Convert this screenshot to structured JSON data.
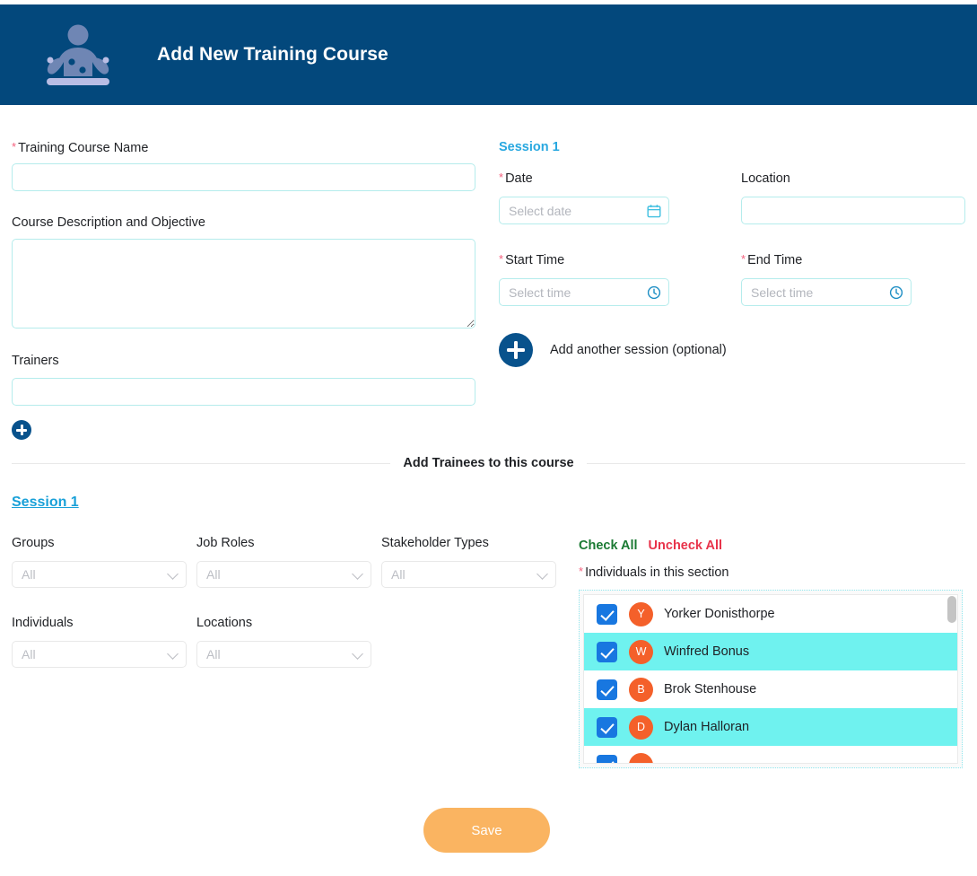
{
  "header": {
    "title": "Add New Training Course",
    "logo_icon": "trainer-person-icon",
    "bg_color": "#03487c"
  },
  "course": {
    "name_label": "Training Course Name",
    "name_value": "",
    "name_placeholder": "",
    "description_label": "Course Description and Objective",
    "description_value": "",
    "description_placeholder": "",
    "trainers_label": "Trainers",
    "trainers_value": "",
    "trainers_placeholder": "",
    "add_trainer_icon": "plus-circle-icon"
  },
  "session": {
    "heading": "Session 1",
    "date_label": "Date",
    "date_placeholder": "Select date",
    "date_value": "",
    "date_icon": "calendar-icon",
    "location_label": "Location",
    "location_value": "",
    "location_placeholder": "",
    "start_time_label": "Start Time",
    "start_time_placeholder": "Select time",
    "start_time_value": "",
    "start_time_icon": "clock-icon",
    "end_time_label": "End Time",
    "end_time_placeholder": "Select time",
    "end_time_value": "",
    "end_time_icon": "clock-icon",
    "add_session_label": "Add another session (optional)",
    "add_session_icon": "plus-circle-icon"
  },
  "trainees": {
    "divider_title": "Add Trainees to this course",
    "session_link": "Session 1",
    "filters": [
      {
        "label": "Groups",
        "value": "All"
      },
      {
        "label": "Job Roles",
        "value": "All"
      },
      {
        "label": "Stakeholder Types",
        "value": "All"
      },
      {
        "label": "Individuals",
        "value": "All"
      },
      {
        "label": "Locations",
        "value": "All"
      }
    ],
    "check_all_label": "Check All",
    "uncheck_all_label": "Uncheck All",
    "individuals_label": "Individuals in this section",
    "individuals": [
      {
        "initial": "Y",
        "name": "Yorker Donisthorpe",
        "checked": true,
        "highlighted": false
      },
      {
        "initial": "W",
        "name": "Winfred Bonus",
        "checked": true,
        "highlighted": true
      },
      {
        "initial": "B",
        "name": "Brok Stenhouse",
        "checked": true,
        "highlighted": false
      },
      {
        "initial": "D",
        "name": "Dylan Halloran",
        "checked": true,
        "highlighted": true
      }
    ]
  },
  "footer": {
    "save_label": "Save"
  },
  "colors": {
    "header_blue": "#03487c",
    "accent_cyan": "#28a8e0",
    "field_border": "#b5ecec",
    "highlight_row": "#6ff2ef",
    "avatar_orange": "#f4602a",
    "checkbox_blue": "#1877e0",
    "check_all_green": "#1a7a33",
    "uncheck_all_red": "#e8334a",
    "save_orange": "#fab461",
    "required_red": "#f4607e"
  }
}
